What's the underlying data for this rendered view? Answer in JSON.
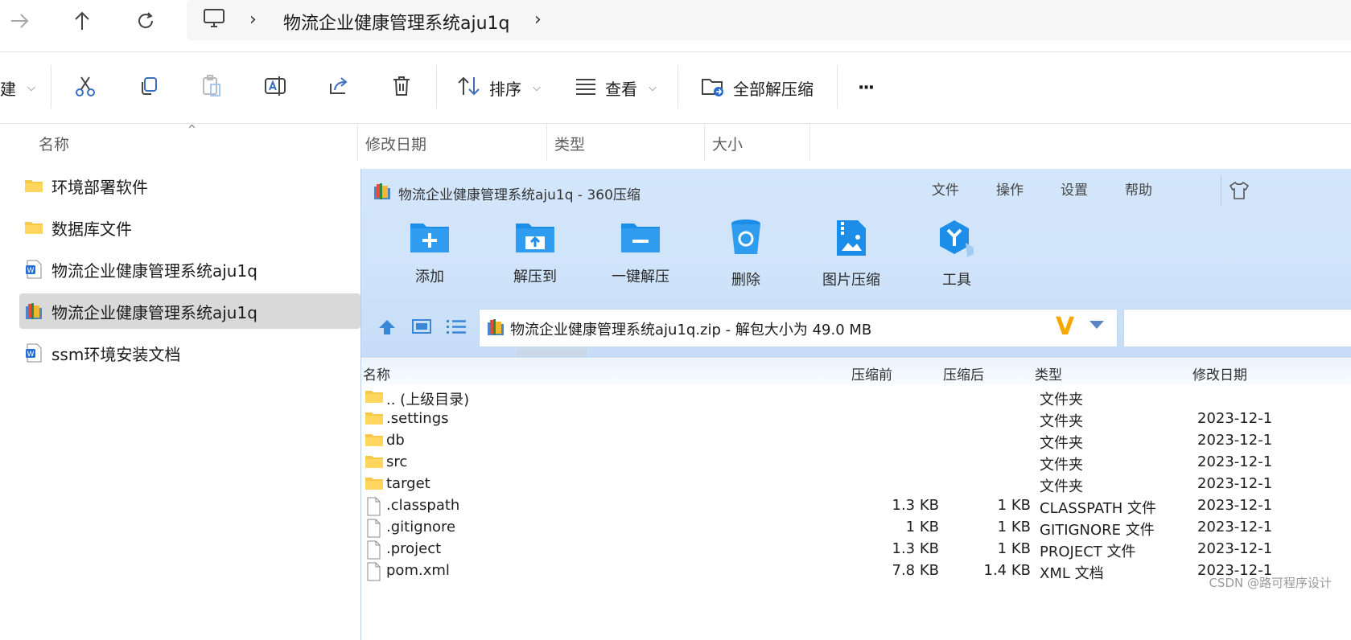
{
  "explorer": {
    "address": {
      "title": "物流企业健康管理系统aju1q",
      "sep1": "›",
      "sep2": "›"
    },
    "toolbar": {
      "new_partial": "建",
      "sort_label": "排序",
      "view_label": "查看",
      "extract_all_label": "全部解压缩",
      "more_label": "···"
    },
    "columns": {
      "name": "名称",
      "modified": "修改日期",
      "type": "类型",
      "size": "大小"
    },
    "files": [
      {
        "name": "环境部署软件",
        "icon": "folder-icon"
      },
      {
        "name": "数据库文件",
        "icon": "folder-icon"
      },
      {
        "name": "物流企业健康管理系统aju1q",
        "icon": "word-doc-icon"
      },
      {
        "name": "物流企业健康管理系统aju1q",
        "icon": "zip-archive-icon",
        "selected": true
      },
      {
        "name": "ssm环境安装文档",
        "icon": "word-doc-icon"
      }
    ]
  },
  "zip": {
    "title": "物流企业健康管理系统aju1q - 360压缩",
    "menu": [
      "文件",
      "操作",
      "设置",
      "帮助"
    ],
    "buttons": [
      {
        "label": "添加",
        "icon": "add-folder-icon"
      },
      {
        "label": "解压到",
        "icon": "extract-to-icon"
      },
      {
        "label": "一键解压",
        "icon": "one-click-extract-icon"
      },
      {
        "label": "删除",
        "icon": "recycle-bin-icon"
      },
      {
        "label": "图片压缩",
        "icon": "image-compress-icon"
      },
      {
        "label": "工具",
        "icon": "tools-icon"
      }
    ],
    "path": "物流企业健康管理系统aju1q.zip - 解包大小为 49.0 MB",
    "path_logo": "V",
    "columns": {
      "name": "名称",
      "before": "压缩前",
      "after": "压缩后",
      "type": "类型",
      "modified": "修改日期"
    },
    "rows": [
      {
        "name": ".. (上级目录)",
        "before": "",
        "after": "",
        "type": "文件夹",
        "date": "",
        "icon": "folder-icon"
      },
      {
        "name": ".settings",
        "before": "",
        "after": "",
        "type": "文件夹",
        "date": "2023-12-1",
        "icon": "folder-icon"
      },
      {
        "name": "db",
        "before": "",
        "after": "",
        "type": "文件夹",
        "date": "2023-12-1",
        "icon": "folder-icon"
      },
      {
        "name": "src",
        "before": "",
        "after": "",
        "type": "文件夹",
        "date": "2023-12-1",
        "icon": "folder-icon"
      },
      {
        "name": "target",
        "before": "",
        "after": "",
        "type": "文件夹",
        "date": "2023-12-1",
        "icon": "folder-icon"
      },
      {
        "name": ".classpath",
        "before": "1.3 KB",
        "after": "1 KB",
        "type": "CLASSPATH 文件",
        "date": "2023-12-1",
        "icon": "file-icon"
      },
      {
        "name": ".gitignore",
        "before": "1 KB",
        "after": "1 KB",
        "type": "GITIGNORE 文件",
        "date": "2023-12-1",
        "icon": "file-icon"
      },
      {
        "name": ".project",
        "before": "1.3 KB",
        "after": "1 KB",
        "type": "PROJECT 文件",
        "date": "2023-12-1",
        "icon": "file-icon"
      },
      {
        "name": "pom.xml",
        "before": "7.8 KB",
        "after": "1.4 KB",
        "type": "XML 文档",
        "date": "2023-12-1",
        "icon": "file-icon"
      }
    ]
  },
  "watermark": "CSDN @路可程序设计",
  "colors": {
    "zip_header_bg": "#d3e6fb",
    "folder": "#f7c948",
    "zip_icon_blue": "#1a8ae6",
    "selected_row": "#d9d9d9"
  }
}
